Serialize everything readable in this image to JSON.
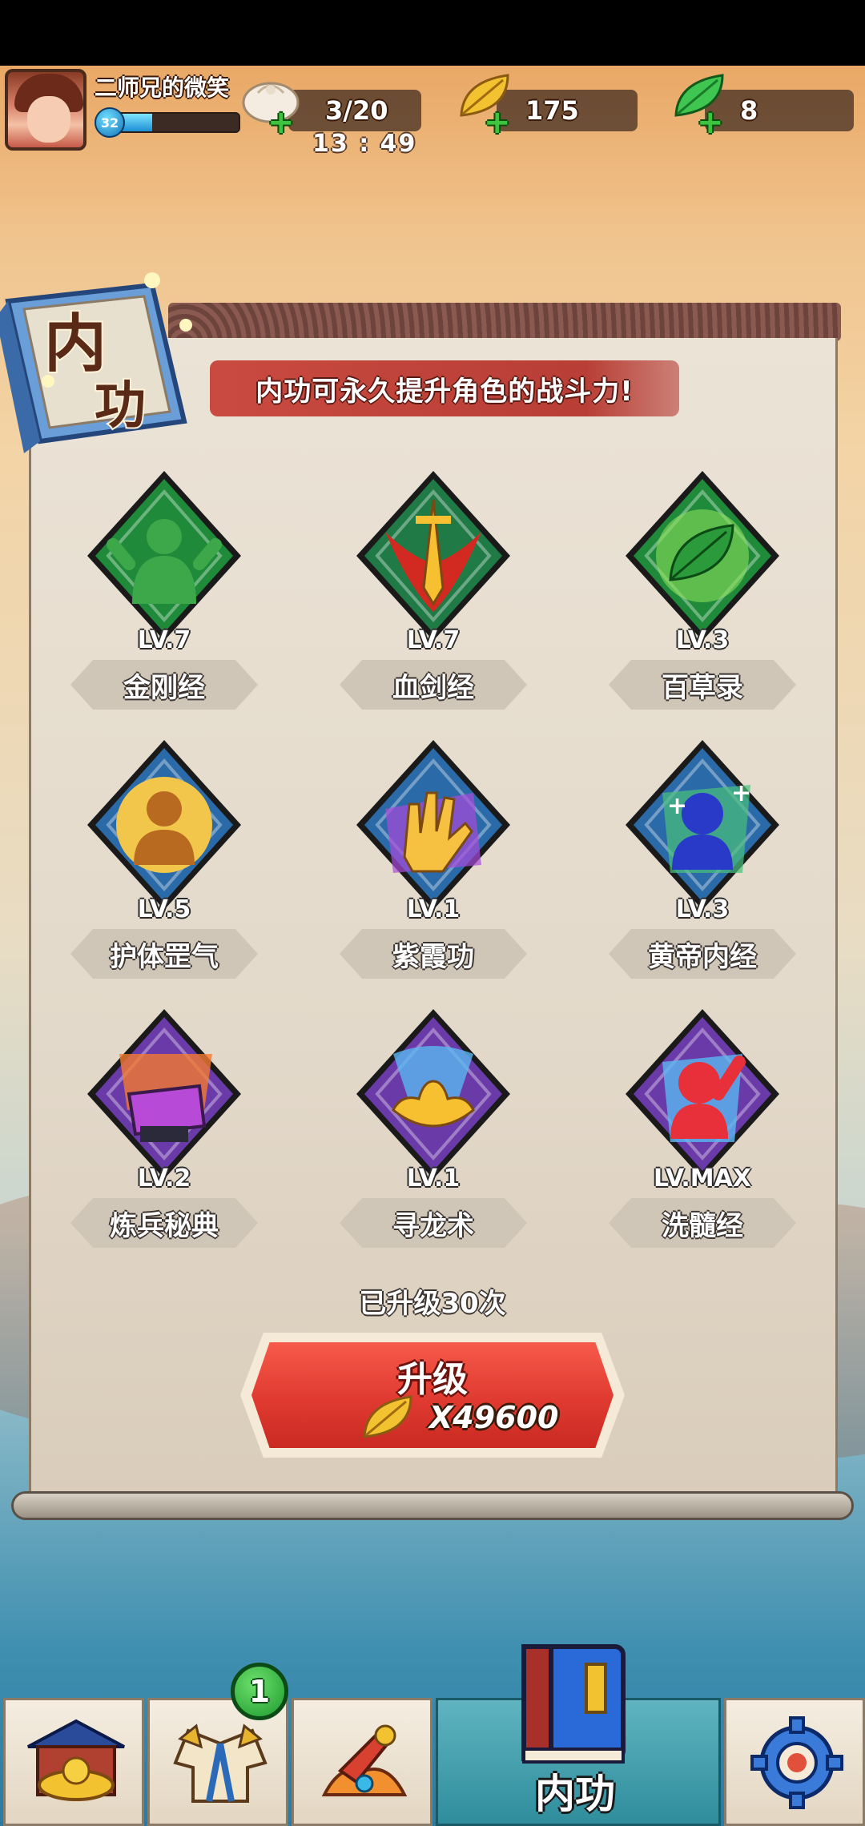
{
  "player": {
    "name": "二师兄的微笑",
    "level": "32",
    "xp_fraction": 0.35
  },
  "resources": {
    "stamina": {
      "value": "3/20",
      "timer": "13 : 49",
      "icon": "steamed-bun-icon"
    },
    "gold_leaf": {
      "value": "175",
      "icon": "gold-leaf-icon"
    },
    "jade_leaf": {
      "value": "8",
      "icon": "green-leaf-icon"
    }
  },
  "header": {
    "title_calligraphy": "内功",
    "banner_text": "内功可永久提升角色的战斗力!"
  },
  "skills": [
    {
      "name": "金刚经",
      "level": "LV.7",
      "icon": "strongman-icon",
      "frame_color": "#1f8a3a"
    },
    {
      "name": "血剑经",
      "level": "LV.7",
      "icon": "blood-sword-icon",
      "frame_color": "#1f7a46"
    },
    {
      "name": "百草录",
      "level": "LV.3",
      "icon": "herb-leaf-icon",
      "frame_color": "#1f8a3a"
    },
    {
      "name": "护体罡气",
      "level": "LV.5",
      "icon": "shield-aura-icon",
      "frame_color": "#2a6aa8"
    },
    {
      "name": "紫霞功",
      "level": "LV.1",
      "icon": "palm-strike-icon",
      "frame_color": "#2a6aa8"
    },
    {
      "name": "黄帝内经",
      "level": "LV.3",
      "icon": "healing-figure-icon",
      "frame_color": "#2a6aa8"
    },
    {
      "name": "炼兵秘典",
      "level": "LV.2",
      "icon": "anvil-icon",
      "frame_color": "#6a3aa8"
    },
    {
      "name": "寻龙术",
      "level": "LV.1",
      "icon": "gold-ingot-icon",
      "frame_color": "#6a3aa8"
    },
    {
      "name": "洗髓经",
      "level": "LV.MAX",
      "icon": "red-figure-icon",
      "frame_color": "#6a3aa8"
    }
  ],
  "upgrade": {
    "count_text": "已升级30次",
    "button_label": "升级",
    "cost": "X49600"
  },
  "nav": {
    "tabs": [
      {
        "id": "shop",
        "icon": "gold-shop-icon"
      },
      {
        "id": "outfit",
        "icon": "robe-icon",
        "badge": "1"
      },
      {
        "id": "weapon",
        "icon": "weapon-icon"
      },
      {
        "id": "neigong",
        "icon": "book-icon",
        "label": "内功",
        "active": true
      },
      {
        "id": "settings",
        "icon": "gear-icon"
      }
    ]
  },
  "colors": {
    "banner_red": "#c94a40",
    "upgrade_red": "#e03a30",
    "active_tab": "#2f8d9c"
  }
}
